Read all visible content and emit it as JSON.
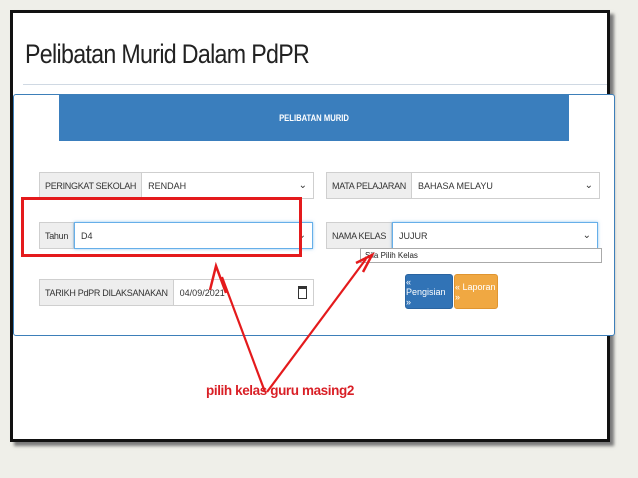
{
  "page": {
    "title": "Pelibatan Murid Dalam PdPR"
  },
  "panel": {
    "header": "PELIBATAN MURID"
  },
  "form": {
    "peringkat": {
      "label": "PERINGKAT SEKOLAH",
      "value": "RENDAH"
    },
    "mata_pelajaran": {
      "label": "MATA PELAJARAN",
      "value": "BAHASA MELAYU"
    },
    "tahun": {
      "label": "Tahun",
      "value": "D4"
    },
    "nama_kelas": {
      "label": "NAMA KELAS",
      "value": "JUJUR",
      "options": [
        "Sila Pilih Kelas"
      ]
    },
    "tarikh": {
      "label": "TARIKH PdPR DILAKSANAKAN",
      "value": "04/09/2021"
    }
  },
  "buttons": {
    "pengisian": "« Pengisian »",
    "laporan": "« Laporan »"
  },
  "annotation": {
    "text": "pilih kelas guru masing2",
    "color": "#d91f26"
  },
  "colors": {
    "panel_header": "#3a7ebd",
    "btn_primary": "#3173b6",
    "btn_warning": "#f0a842",
    "highlight": "#e41a1c"
  },
  "icons": {
    "select": "chevron-down-icon",
    "date": "calendar-icon"
  }
}
